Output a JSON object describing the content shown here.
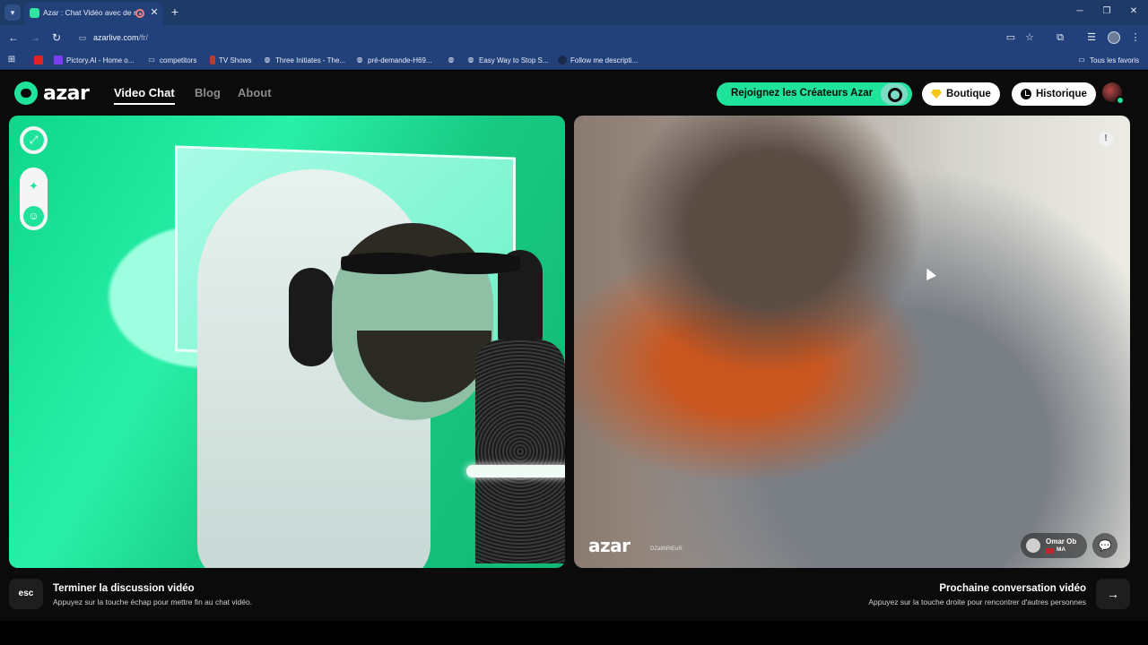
{
  "browser": {
    "tab_title": "Azar : Chat Vidéo avec de n",
    "url_host": "azarlive.com",
    "url_path": "/fr/",
    "bookmarks": [
      {
        "label": "",
        "icon": "youtube-icon"
      },
      {
        "label": "Pictory.AI - Home o...",
        "icon": "pictory-icon"
      },
      {
        "label": "competitors",
        "icon": "folder-icon"
      },
      {
        "label": "TV Shows",
        "icon": "bookmark-icon"
      },
      {
        "label": "Three Initiates - The...",
        "icon": "globe-icon"
      },
      {
        "label": "pré-demande-H69...",
        "icon": "globe-icon"
      },
      {
        "label": "Easy Way to Stop S...",
        "icon": "globe-icon"
      },
      {
        "label": "Follow me descripti...",
        "icon": "site-icon"
      },
      {
        "label": "Tous les favoris",
        "icon": "folder-icon"
      }
    ]
  },
  "app": {
    "logo_text": "azar",
    "nav": [
      {
        "label": "Video Chat",
        "active": true
      },
      {
        "label": "Blog",
        "active": false
      },
      {
        "label": "About",
        "active": false
      }
    ],
    "creator_button": "Rejoignez les Créateurs Azar",
    "shop_button": "Boutique",
    "history_button": "Historique",
    "accent_color": "#1fe39a"
  },
  "remote": {
    "watermark": "azar",
    "watermark_id": "DZa8hRtEuR",
    "user_name": "Omar Ob",
    "user_country": "MA"
  },
  "hints": {
    "esc_key": "esc",
    "end_title": "Terminer la discussion vidéo",
    "end_sub": "Appuyez sur la touche échap pour mettre fin au chat vidéo.",
    "next_title": "Prochaine conversation vidéo",
    "next_sub": "Appuyez sur la touche droite pour rencontrer d'autres personnes"
  }
}
